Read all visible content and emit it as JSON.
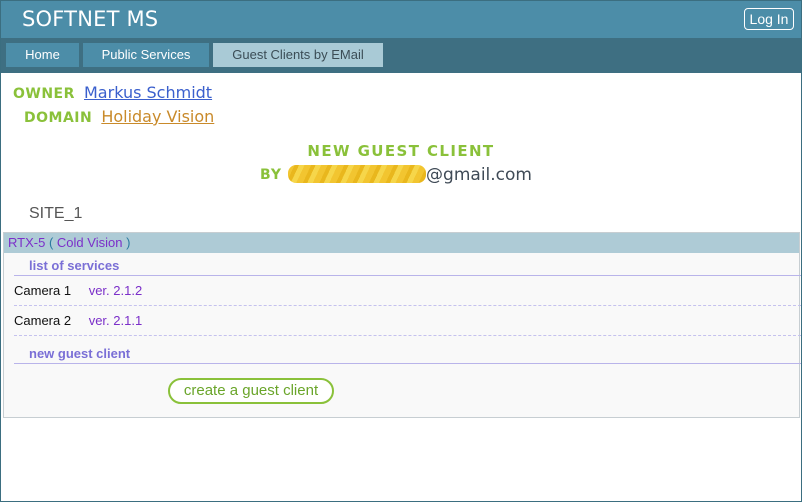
{
  "header": {
    "app_title": "SOFTNET MS",
    "login_label": "Log In"
  },
  "nav": {
    "tabs": [
      {
        "label": "Home"
      },
      {
        "label": "Public Services"
      },
      {
        "label": "Guest Clients by EMail",
        "active": true
      }
    ]
  },
  "owner": {
    "label": "OWNER",
    "name": "Markus Schmidt"
  },
  "domain": {
    "label": "DOMAIN",
    "name": "Holiday Vision"
  },
  "heading": {
    "title": "NEW GUEST CLIENT",
    "by_label": "BY",
    "email_visible": "@gmail.com",
    "email_local_part": "redacted"
  },
  "site": {
    "name": "SITE_1"
  },
  "device": {
    "name": "RTX-5",
    "alias_open": "(",
    "alias": "Cold Vision",
    "alias_close": ")",
    "services_label": "list of services",
    "services": [
      {
        "name": "Camera 1",
        "version": "ver. 2.1.2"
      },
      {
        "name": "Camera 2",
        "version": "ver. 2.1.1"
      }
    ],
    "new_guest_label": "new guest client",
    "create_button": "create a guest client"
  },
  "colors": {
    "header_bg": "#4c8da8",
    "nav_bg": "#3e6f82",
    "accent_green": "#8ac13a",
    "device_purple": "#7b2fc9",
    "panel_header_bg": "#aecbd6"
  }
}
